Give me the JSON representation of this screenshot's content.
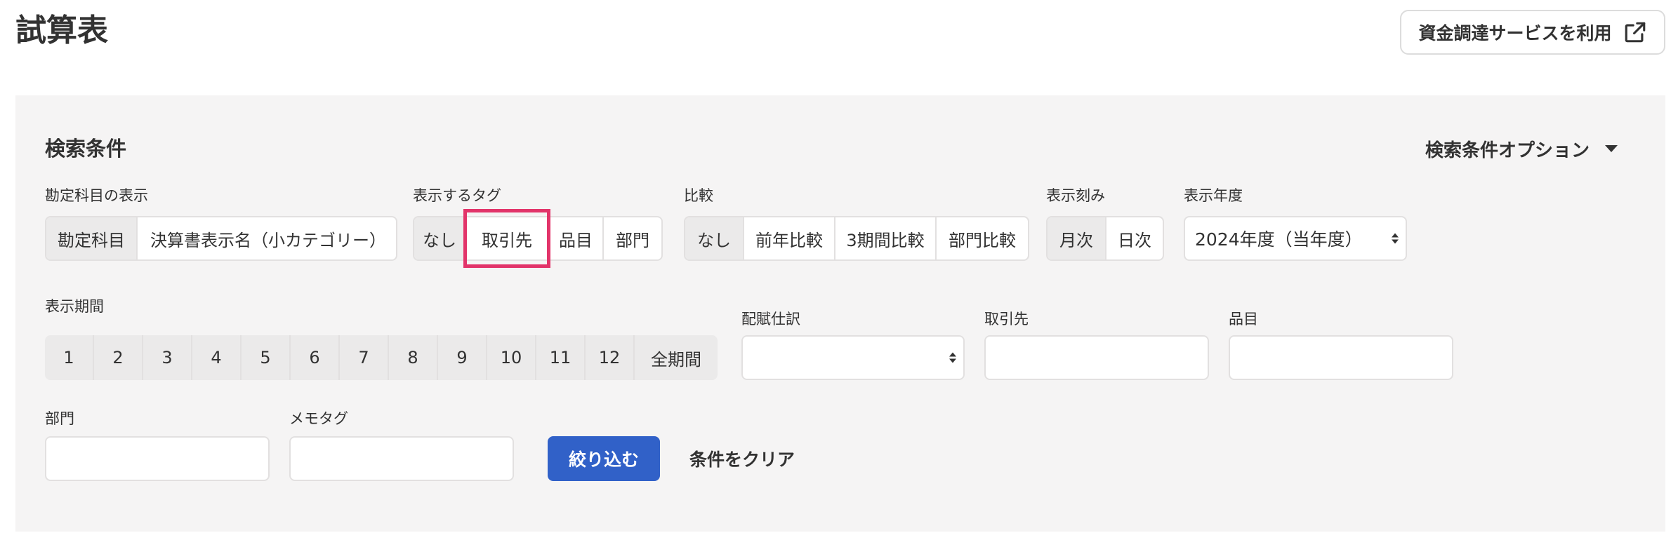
{
  "page": {
    "title": "試算表"
  },
  "header": {
    "funding_button": "資金調達サービスを利用",
    "funding_icon": "external-link-icon"
  },
  "search": {
    "title": "検索条件",
    "options_label": "検索条件オプション",
    "account_display": {
      "label": "勘定科目の表示",
      "options": [
        "勘定科目",
        "決算書表示名（小カテゴリー）"
      ],
      "selected": 0
    },
    "tag_display": {
      "label": "表示するタグ",
      "options": [
        "なし",
        "取引先",
        "品目",
        "部門"
      ],
      "selected": 0,
      "highlighted": 1
    },
    "compare": {
      "label": "比較",
      "options": [
        "なし",
        "前年比較",
        "3期間比較",
        "部門比較"
      ],
      "selected": 0
    },
    "step": {
      "label": "表示刻み",
      "options": [
        "月次",
        "日次"
      ],
      "selected": 0
    },
    "fiscal_year": {
      "label": "表示年度",
      "value": "2024年度（当年度）"
    },
    "period": {
      "label": "表示期間",
      "options": [
        "1",
        "2",
        "3",
        "4",
        "5",
        "6",
        "7",
        "8",
        "9",
        "10",
        "11",
        "12",
        "全期間"
      ]
    },
    "allocation": {
      "label": "配賦仕訳",
      "value": ""
    },
    "partner": {
      "label": "取引先",
      "value": ""
    },
    "item": {
      "label": "品目",
      "value": ""
    },
    "department": {
      "label": "部門",
      "value": ""
    },
    "memo_tag": {
      "label": "メモタグ",
      "value": ""
    },
    "filter_button": "絞り込む",
    "clear_button": "条件をクリア"
  },
  "colors": {
    "accent": "#3161c8",
    "highlight": "#e2346a",
    "panel_bg": "#f5f4f4"
  }
}
